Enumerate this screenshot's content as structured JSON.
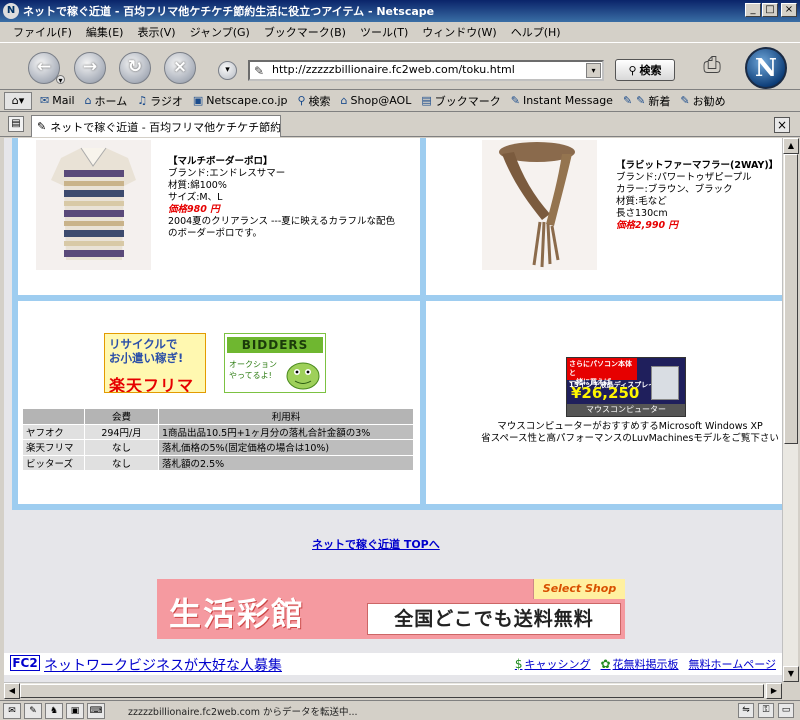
{
  "window": {
    "app_icon": "netscape-icon",
    "title": "ネットで稼ぐ近道 - 百均フリマ他ケチケチ節約生活に役立つアイテム - Netscape",
    "controls": [
      "_",
      "□",
      "×"
    ]
  },
  "menu": [
    "ファイル(F)",
    "編集(E)",
    "表示(V)",
    "ジャンプ(G)",
    "ブックマーク(B)",
    "ツール(T)",
    "ウィンドウ(W)",
    "ヘルプ(H)"
  ],
  "navbar": {
    "url": "http://zzzzzbillionaire.fc2web.com/toku.html",
    "search_label": "検索"
  },
  "personal_toolbar": [
    {
      "icon": "mail-icon",
      "glyph": "✉",
      "label": "Mail"
    },
    {
      "icon": "home-icon",
      "glyph": "⌂",
      "label": "ホーム"
    },
    {
      "icon": "radio-icon",
      "glyph": "♫",
      "label": "ラジオ"
    },
    {
      "icon": "my-icon",
      "glyph": "▣",
      "label": "Netscape.co.jp"
    },
    {
      "icon": "search-icon",
      "glyph": "⚲",
      "label": "検索"
    },
    {
      "icon": "shop-icon",
      "glyph": "⌂",
      "label": "Shop@AOL"
    },
    {
      "icon": "bookmark-icon",
      "glyph": "▤",
      "label": "ブックマーク"
    },
    {
      "icon": "im-icon",
      "glyph": "✎",
      "label": "Instant Message"
    },
    {
      "icon": "link-icon",
      "glyph": "✎",
      "label": ""
    },
    {
      "icon": "new-icon",
      "glyph": "✎",
      "label": "新着"
    },
    {
      "icon": "recommend-icon",
      "glyph": "✎",
      "label": "お勧め"
    }
  ],
  "tab": {
    "label": "ネットで稼ぐ近道 - 百均フリマ他ケチケチ節約..."
  },
  "products": {
    "polo": {
      "title": "【マルチボーダーポロ】",
      "brand": "ブランド:エンドレスサマー",
      "material": "材質:綿100%",
      "size": "サイズ:M、L",
      "price": "価格980 円",
      "desc1": "2004夏のクリアランス ---夏に映えるカラフルな配色",
      "desc2": "のボーダーポロです。"
    },
    "scarf": {
      "title": "【ラビットファーマフラー(2WAY)】",
      "brand": "ブランド:パワートゥザピープル",
      "color": "カラー:ブラウン、ブラック",
      "material": "材質:毛など",
      "length": "長さ130cm",
      "price": "価格2,990 円"
    }
  },
  "banners": {
    "recycle_line1": "リサイクルで",
    "recycle_line2": "お小遣い稼ぎ!",
    "rakuten": "楽天フリマ",
    "bidders": "BIDDERS",
    "bidders_sub1": "オークション",
    "bidders_sub2": "やってるよ!",
    "mouse_top1": "さらにパソコン本体と",
    "mouse_top2": "一緒に買えば",
    "mouse_lcd": "15インチ液晶ディスプレイが",
    "mouse_price": "¥26,250",
    "mouse_foot": "マウスコンピューター",
    "seikatsu_logo": "生活彩館",
    "seikatsu_shop": "Select Shop",
    "seikatsu_free": "全国どこでも送料無料"
  },
  "fee_table": {
    "headers": [
      "",
      "会費",
      "利用料"
    ],
    "rows": [
      [
        "ヤフオク",
        "294円/月",
        "1商品出品10.5円+1ヶ月分の落札合計金額の3%"
      ],
      [
        "楽天フリマ",
        "なし",
        "落札価格の5%(固定価格の場合は10%)"
      ],
      [
        "ビッターズ",
        "なし",
        "落札額の2.5%"
      ]
    ]
  },
  "mouse": {
    "line1": "マウスコンピューターがおすすめするMicrosoft Windows XP",
    "line2": "省スペース性と高パフォーマンスのLuvMachinesモデルをご覧下さい"
  },
  "links": {
    "top": "ネットで稼ぐ近道 TOPへ",
    "fc2": "FC2",
    "recruit": "ネットワークビジネスが大好な人募集",
    "cashing": "キャッシング",
    "flower": "花無料掲示板",
    "homepage": "無料ホームページ"
  },
  "status": {
    "text": "zzzzzbillionaire.fc2web.com からデータを転送中..."
  }
}
